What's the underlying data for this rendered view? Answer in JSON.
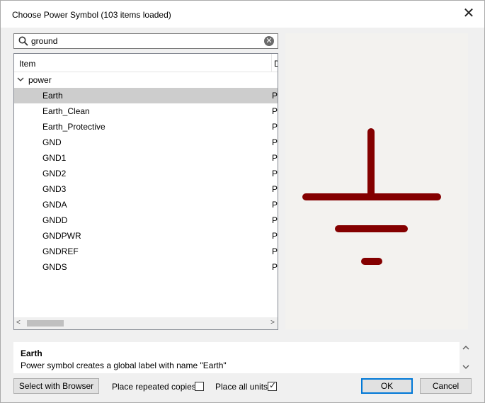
{
  "window": {
    "title": "Choose Power Symbol (103 items loaded)",
    "close_glyph": "✕"
  },
  "search": {
    "value": "ground",
    "placeholder": "",
    "search_icon": "search-icon",
    "clear_icon": "clear-icon",
    "clear_glyph": "✕"
  },
  "tree": {
    "columns": {
      "item": "Item",
      "description": "D"
    },
    "group": {
      "label": "power",
      "expanded": true,
      "chevron": "⌄"
    },
    "items": [
      {
        "label": "Earth",
        "desc": "P",
        "selected": true
      },
      {
        "label": "Earth_Clean",
        "desc": "P"
      },
      {
        "label": "Earth_Protective",
        "desc": "P"
      },
      {
        "label": "GND",
        "desc": "P"
      },
      {
        "label": "GND1",
        "desc": "P"
      },
      {
        "label": "GND2",
        "desc": "P"
      },
      {
        "label": "GND3",
        "desc": "P"
      },
      {
        "label": "GNDA",
        "desc": "P"
      },
      {
        "label": "GNDD",
        "desc": "P"
      },
      {
        "label": "GNDPWR",
        "desc": "P"
      },
      {
        "label": "GNDREF",
        "desc": "P"
      },
      {
        "label": "GNDS",
        "desc": "P"
      }
    ],
    "scroll_left_glyph": "<",
    "scroll_right_glyph": ">"
  },
  "preview": {
    "symbol": "earth-ground-symbol",
    "stroke_color": "#840000",
    "background": "#f3f2ef"
  },
  "description": {
    "title": "Earth",
    "text": "Power symbol creates a global label with name \"Earth\"",
    "scroll_up_glyph": "^",
    "scroll_down_glyph": "v"
  },
  "footer": {
    "select_browser": "Select with Browser",
    "place_repeated": "Place repeated copies",
    "place_repeated_checked": false,
    "place_all_units": "Place all units",
    "place_all_units_checked": true,
    "checkmark_glyph": "✓",
    "ok": "OK",
    "cancel": "Cancel"
  },
  "colors": {
    "selected_row": "#cdcdcd",
    "default_button_border": "#0078d7"
  }
}
